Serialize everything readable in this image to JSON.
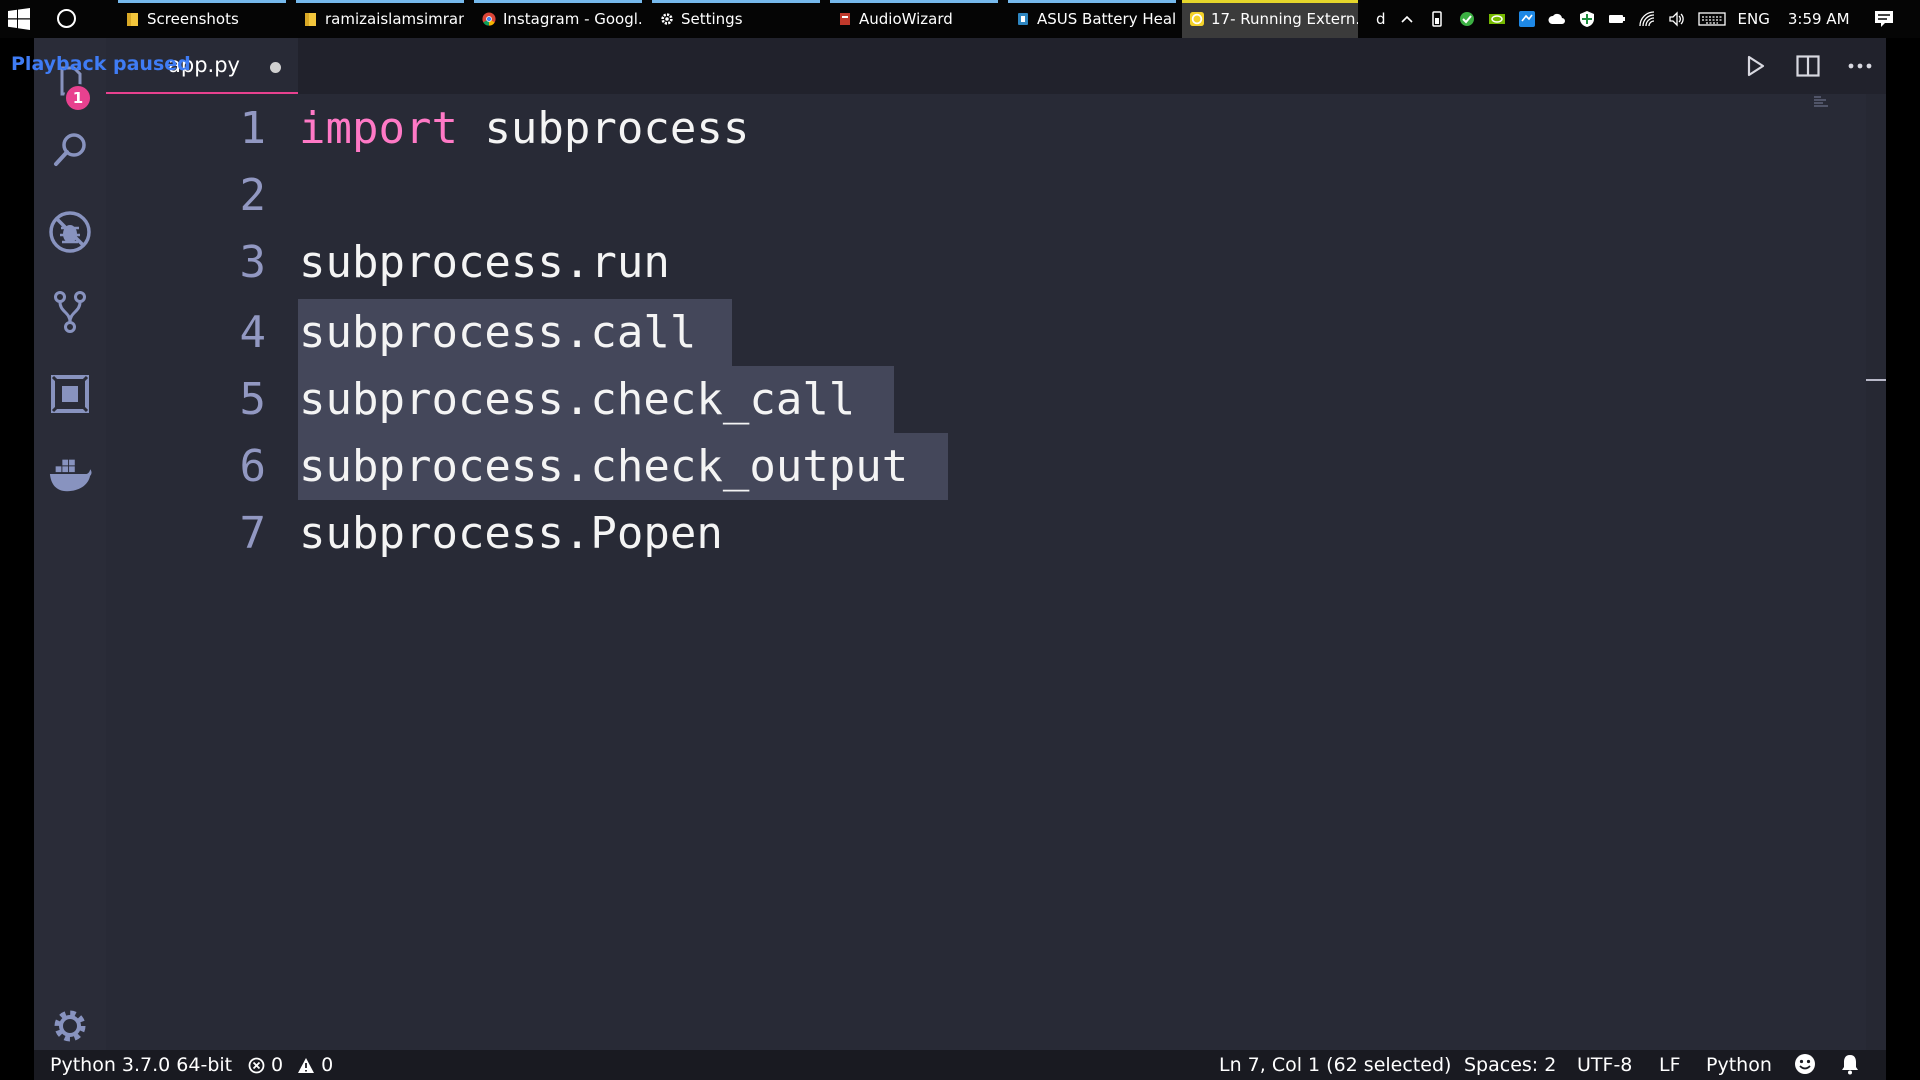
{
  "taskbar": {
    "apps": [
      {
        "label": "Screenshots",
        "icon": "folder-icon"
      },
      {
        "label": "ramizaislamsimran...",
        "icon": "folder-icon"
      },
      {
        "label": "Instagram - Googl...",
        "icon": "chrome-icon"
      },
      {
        "label": "Settings",
        "icon": "gear-icon"
      },
      {
        "label": "AudioWizard",
        "icon": "audiowizard-icon"
      },
      {
        "label": "ASUS Battery Heal...",
        "icon": "battery-health-icon"
      },
      {
        "label": "17- Running Extern...",
        "icon": "video-player-icon"
      }
    ],
    "tray": {
      "overflow_text": "d",
      "language": "ENG",
      "time": "3:59 AM"
    }
  },
  "overlay": {
    "playback_text": "Playback paused"
  },
  "activity_bar": {
    "badge_count": "1",
    "items": [
      "explorer-icon",
      "search-icon",
      "debug-icon",
      "source-control-icon",
      "extensions-icon",
      "docker-icon"
    ],
    "bottom": "settings-gear-icon"
  },
  "tabs": [
    {
      "name": "app.py",
      "dirty": true,
      "active": true
    }
  ],
  "editor": {
    "lines": [
      {
        "number": "1",
        "tokens": [
          {
            "text": "import",
            "kind": "keyword"
          },
          {
            "text": " subprocess",
            "kind": "plain"
          }
        ]
      },
      {
        "number": "2",
        "tokens": []
      },
      {
        "number": "3",
        "tokens": [
          {
            "text": "subprocess.run",
            "kind": "plain"
          }
        ]
      },
      {
        "number": "4",
        "tokens": [
          {
            "text": "subprocess.call",
            "kind": "plain"
          }
        ],
        "selected": true
      },
      {
        "number": "5",
        "tokens": [
          {
            "text": "subprocess.check_call",
            "kind": "plain"
          }
        ],
        "selected": true
      },
      {
        "number": "6",
        "tokens": [
          {
            "text": "subprocess.check_output",
            "kind": "plain"
          }
        ],
        "selected": true
      },
      {
        "number": "7",
        "tokens": [
          {
            "text": "subprocess.Popen",
            "kind": "plain"
          }
        ]
      }
    ]
  },
  "statusbar": {
    "interpreter": "Python 3.7.0 64-bit",
    "errors": "0",
    "warnings": "0",
    "cursor": "Ln 7, Col 1 (62 selected)",
    "indent": "Spaces: 2",
    "encoding": "UTF-8",
    "eol": "LF",
    "language": "Python"
  },
  "colors": {
    "editor_bg": "#282a36",
    "keyword": "#ff79c6",
    "selection": "#44475a",
    "accent": "#e8418f",
    "line_number": "#9298c2"
  }
}
